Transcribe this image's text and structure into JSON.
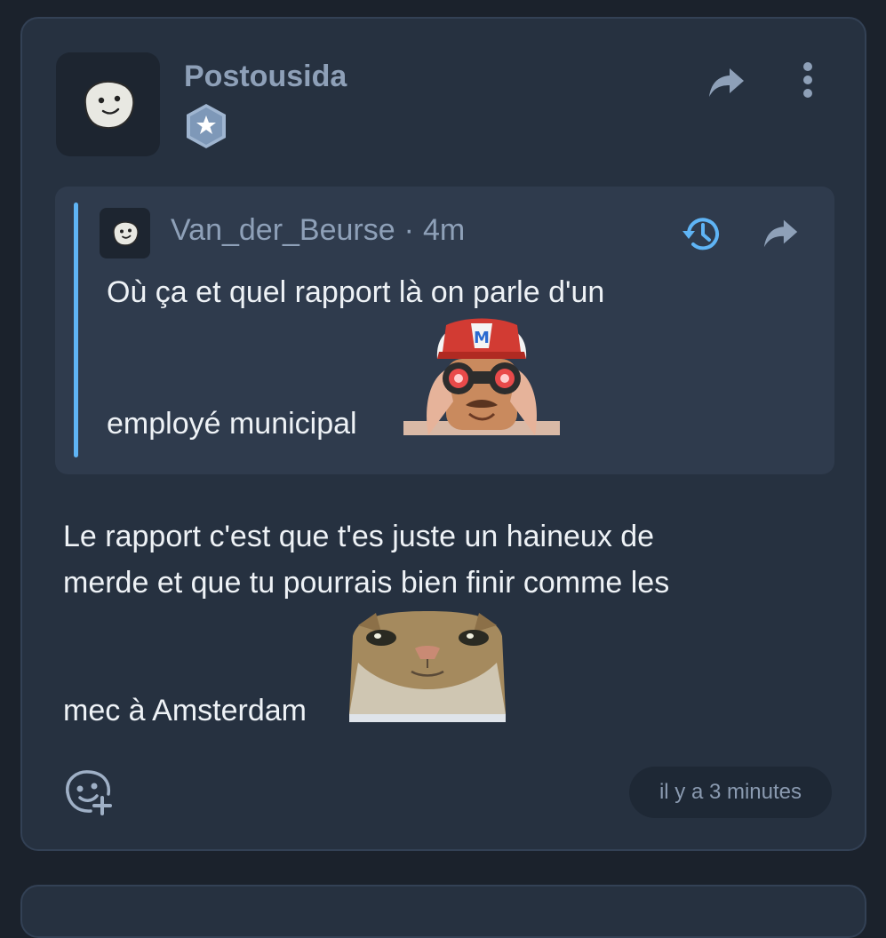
{
  "post": {
    "author": "Postousida",
    "badge_icon": "star-badge-icon",
    "quote": {
      "author": "Van_der_Beurse",
      "separator": "·",
      "time": "4m",
      "line1": "Où ça et quel rapport là on parle d'un",
      "line2": "employé municipal",
      "emoji": "binoculars-man-emoji"
    },
    "body": {
      "line1": "Le rapport c'est que t'es juste un haineux de",
      "line2": "merde et que tu pourrais bien finir comme les",
      "line3": "mec à Amsterdam",
      "emoji": "staring-cat-emoji"
    },
    "timestamp": "il y a 3 minutes"
  },
  "colors": {
    "background": "#1b222c",
    "card": "#263140",
    "quote_bg": "#2f3b4d",
    "quote_bar": "#5fb4f5",
    "accent_blue": "#5fb4f5",
    "muted_text": "#8ea0b8",
    "body_text": "#eef2f6"
  }
}
